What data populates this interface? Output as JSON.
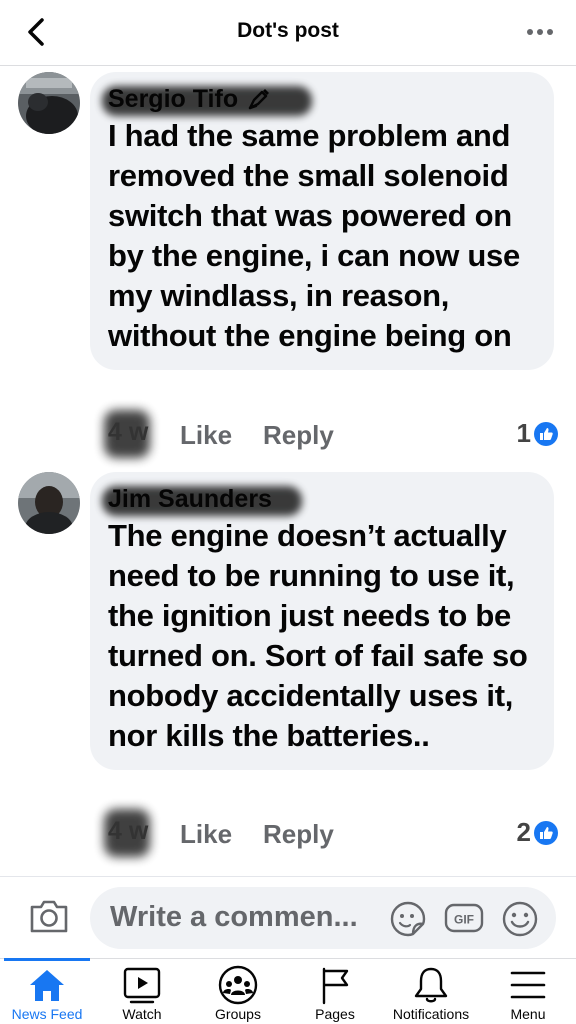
{
  "header": {
    "title": "Dot's post"
  },
  "comments": [
    {
      "author": "Sergio Tifo",
      "text": "I had the same problem and removed the small solenoid switch that was powered on by the engine, i can now use my windlass, in reason, without the engine being on",
      "time": "4 w",
      "like_label": "Like",
      "reply_label": "Reply",
      "reaction_count": "1"
    },
    {
      "author": "Jim Saunders",
      "text": "The engine doesn’t actually need to be running to use it, the ignition just needs to be turned on. Sort of fail safe so nobody accidentally uses it, nor kills the batteries..",
      "time": "4 w",
      "like_label": "Like",
      "reply_label": "Reply",
      "reaction_count": "2"
    }
  ],
  "composer": {
    "placeholder": "Write a commen..."
  },
  "tabs": [
    {
      "label": "News Feed",
      "icon": "home-icon",
      "active": true
    },
    {
      "label": "Watch",
      "icon": "watch-icon",
      "active": false
    },
    {
      "label": "Groups",
      "icon": "groups-icon",
      "active": false
    },
    {
      "label": "Pages",
      "icon": "flag-icon",
      "active": false
    },
    {
      "label": "Notifications",
      "icon": "bell-icon",
      "active": false
    },
    {
      "label": "Menu",
      "icon": "menu-icon",
      "active": false
    }
  ],
  "colors": {
    "accent": "#1877f2",
    "bubble": "#f0f2f5",
    "secondary_text": "#65676b"
  }
}
